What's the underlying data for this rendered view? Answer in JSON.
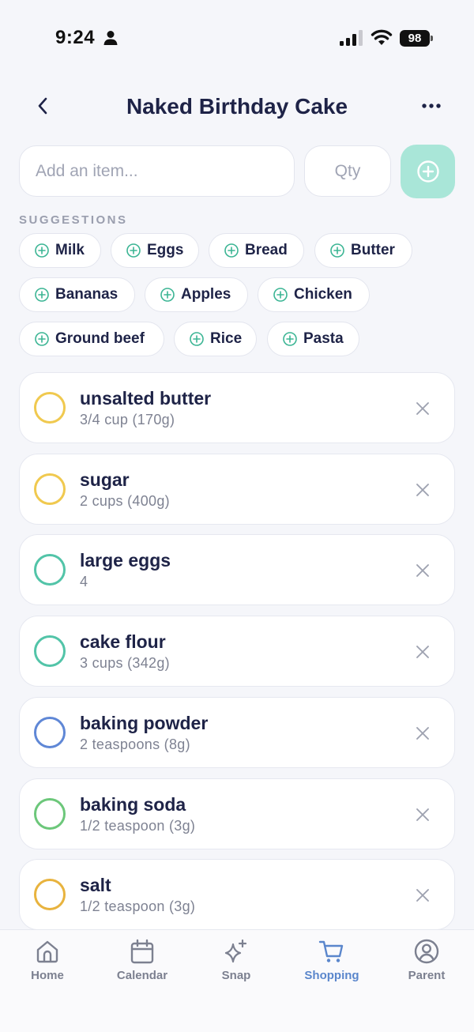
{
  "status_bar": {
    "time": "9:24",
    "battery": "98"
  },
  "header": {
    "title": "Naked Birthday Cake"
  },
  "add_item": {
    "item_placeholder": "Add an item...",
    "qty_placeholder": "Qty"
  },
  "suggestions": {
    "label": "SUGGESTIONS",
    "chips": [
      "Milk",
      "Eggs",
      "Bread",
      "Butter",
      "Bananas",
      "Apples",
      "Chicken",
      "Ground beef",
      "Rice",
      "Pasta"
    ]
  },
  "items": [
    {
      "name": "unsalted butter",
      "qty": "3/4 cup (170g)",
      "color": "#f0c94f"
    },
    {
      "name": "sugar",
      "qty": "2 cups (400g)",
      "color": "#f0c94f"
    },
    {
      "name": "large eggs",
      "qty": "4",
      "color": "#52c4a8"
    },
    {
      "name": "cake flour",
      "qty": "3 cups (342g)",
      "color": "#52c4a8"
    },
    {
      "name": "baking powder",
      "qty": "2 teaspoons (8g)",
      "color": "#5f87d6"
    },
    {
      "name": "baking soda",
      "qty": "1/2 teaspoon (3g)",
      "color": "#6cc77a"
    },
    {
      "name": "salt",
      "qty": "1/2 teaspoon (3g)",
      "color": "#e8b33e"
    }
  ],
  "tabs": [
    {
      "label": "Home",
      "icon": "home-icon"
    },
    {
      "label": "Calendar",
      "icon": "calendar-icon"
    },
    {
      "label": "Snap",
      "icon": "sparkle-icon"
    },
    {
      "label": "Shopping",
      "icon": "cart-icon",
      "active": true
    },
    {
      "label": "Parent",
      "icon": "person-circle-icon"
    }
  ],
  "colors": {
    "accent": "#5a86cc",
    "add_button": "#a9e6d8",
    "chip_icon": "#3bb594",
    "title": "#1e2347"
  }
}
